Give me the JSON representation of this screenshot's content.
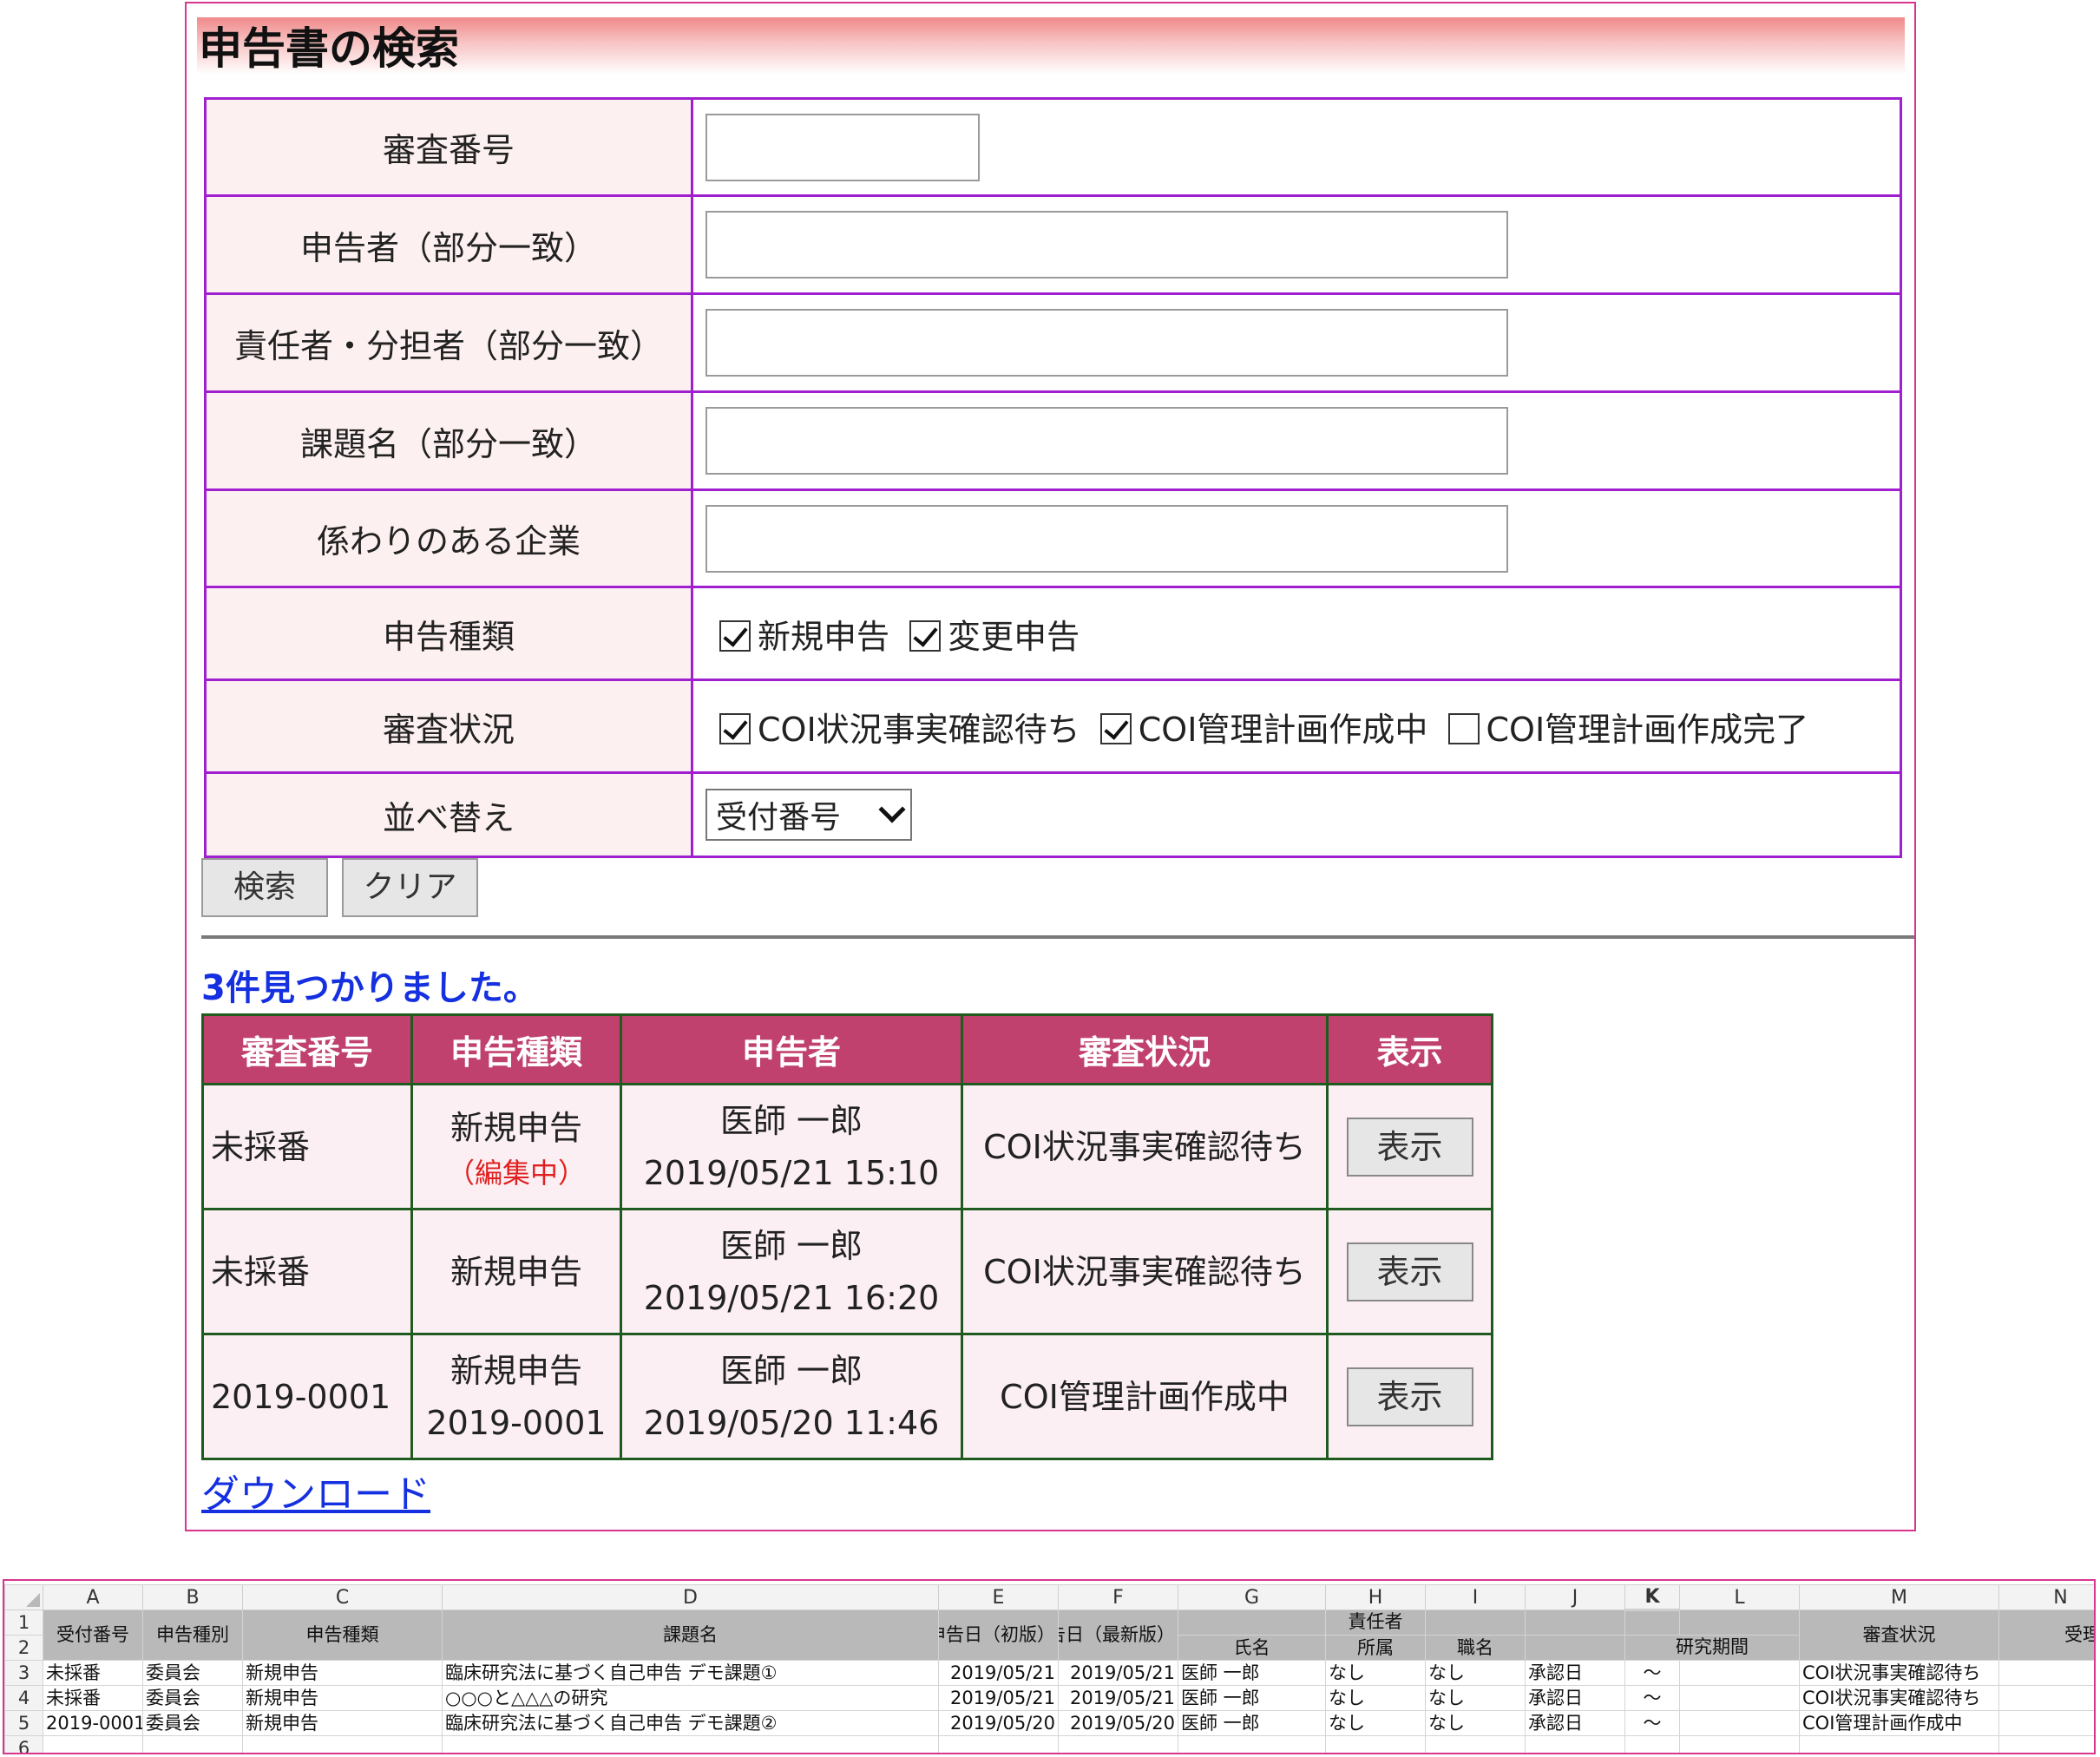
{
  "panel": {
    "title": "申告書の検索"
  },
  "form": {
    "review_number": {
      "label": "審査番号",
      "value": ""
    },
    "declarant": {
      "label": "申告者（部分一致）",
      "value": ""
    },
    "responsible": {
      "label": "責任者・分担者（部分一致）",
      "value": ""
    },
    "project_name": {
      "label": "課題名（部分一致）",
      "value": ""
    },
    "company": {
      "label": "係わりのある企業",
      "value": ""
    },
    "declaration_type": {
      "label": "申告種類",
      "options": [
        {
          "label": "新規申告",
          "checked": true
        },
        {
          "label": "変更申告",
          "checked": true
        }
      ]
    },
    "review_status": {
      "label": "審査状況",
      "options": [
        {
          "label": "COI状況事実確認待ち",
          "checked": true
        },
        {
          "label": "COI管理計画作成中",
          "checked": true
        },
        {
          "label": "COI管理計画作成完了",
          "checked": false
        }
      ]
    },
    "sort": {
      "label": "並べ替え",
      "selected": "受付番号"
    },
    "search_button": "検索",
    "clear_button": "クリア"
  },
  "results": {
    "found_text": "3件見つかりました。",
    "columns": [
      "審査番号",
      "申告種類",
      "申告者",
      "審査状況",
      "表示"
    ],
    "rows": [
      {
        "number": "未採番",
        "type": "新規申告",
        "type_note": "（編集中）",
        "type_sub": "",
        "declarant": "医師 一郎",
        "datetime": "2019/05/21 15:10",
        "status": "COI状況事実確認待ち",
        "button": "表示"
      },
      {
        "number": "未採番",
        "type": "新規申告",
        "type_note": "",
        "type_sub": "",
        "declarant": "医師 一郎",
        "datetime": "2019/05/21 16:20",
        "status": "COI状況事実確認待ち",
        "button": "表示"
      },
      {
        "number": "2019-0001",
        "type": "新規申告",
        "type_note": "",
        "type_sub": "2019-0001",
        "declarant": "医師 一郎",
        "datetime": "2019/05/20 11:46",
        "status": "COI管理計画作成中",
        "button": "表示"
      }
    ],
    "download_link": "ダウンロード"
  },
  "spreadsheet": {
    "column_letters": [
      "A",
      "B",
      "C",
      "D",
      "E",
      "F",
      "G",
      "H",
      "I",
      "J",
      "K",
      "L",
      "M",
      "N"
    ],
    "selected_column": "K",
    "row_numbers": [
      "1",
      "2",
      "3",
      "4",
      "5",
      "6"
    ],
    "header": {
      "receipt_no": "受付番号",
      "category": "申告種別",
      "type": "申告種類",
      "project": "課題名",
      "date_first": "申告日（初版）",
      "date_latest": "申告日（最新版）",
      "responsible": "責任者",
      "name": "氏名",
      "affiliation": "所属",
      "title": "職名",
      "period": "研究期間",
      "status": "審査状況",
      "accepted": "受理日"
    },
    "rows": [
      {
        "receipt_no": "未採番",
        "category": "委員会",
        "type": "新規申告",
        "project": "臨床研究法に基づく自己申告 デモ課題①",
        "date_first": "2019/05/21",
        "date_latest": "2019/05/21",
        "name": "医師 一郎",
        "affiliation": "なし",
        "title": "なし",
        "approval": "承認日",
        "tilde": "～",
        "status": "COI状況事実確認待ち"
      },
      {
        "receipt_no": "未採番",
        "category": "委員会",
        "type": "新規申告",
        "project": "○○○と△△△の研究",
        "date_first": "2019/05/21",
        "date_latest": "2019/05/21",
        "name": "医師 一郎",
        "affiliation": "なし",
        "title": "なし",
        "approval": "承認日",
        "tilde": "～",
        "status": "COI状況事実確認待ち"
      },
      {
        "receipt_no": "2019-0001",
        "category": "委員会",
        "type": "新規申告",
        "project": "臨床研究法に基づく自己申告 デモ課題②",
        "date_first": "2019/05/20",
        "date_latest": "2019/05/20",
        "name": "医師 一郎",
        "affiliation": "なし",
        "title": "なし",
        "approval": "承認日",
        "tilde": "～",
        "status": "COI管理計画作成中"
      }
    ]
  }
}
